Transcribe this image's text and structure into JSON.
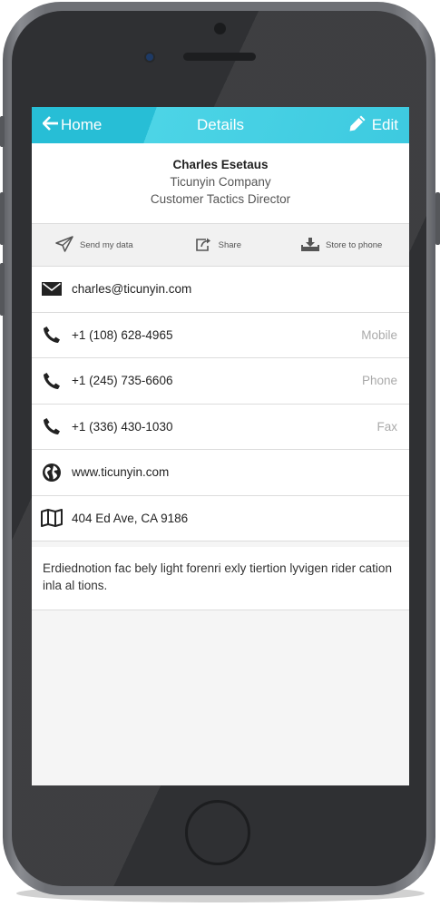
{
  "colors": {
    "accent": "#27bed6",
    "accent_light": "#4cd4e6"
  },
  "nav": {
    "back_label": "Home",
    "title": "Details",
    "edit_label": "Edit"
  },
  "profile": {
    "name": "Charles Esetaus",
    "company": "Ticunyin Company",
    "job_title": "Customer Tactics Director"
  },
  "actions": {
    "send": "Send my data",
    "share": "Share",
    "store": "Store to phone"
  },
  "contact": {
    "email": "charles@ticunyin.com",
    "mobile": {
      "value": "+1 (108) 628-4965",
      "label": "Mobile"
    },
    "phone": {
      "value": "+1 (245) 735-6606",
      "label": "Phone"
    },
    "fax": {
      "value": "+1 (336) 430-1030",
      "label": "Fax"
    },
    "website": "www.ticunyin.com",
    "address": "404 Ed Ave, CA 9186"
  },
  "note": "Erdiednotion fac bely light forenri exly tiertion lyvigen rider cation inla al tions.",
  "icons": [
    "arrow-left-icon",
    "pencil-icon",
    "paper-plane-icon",
    "share-icon",
    "download-icon",
    "envelope-icon",
    "phone-icon",
    "globe-icon",
    "map-icon"
  ]
}
